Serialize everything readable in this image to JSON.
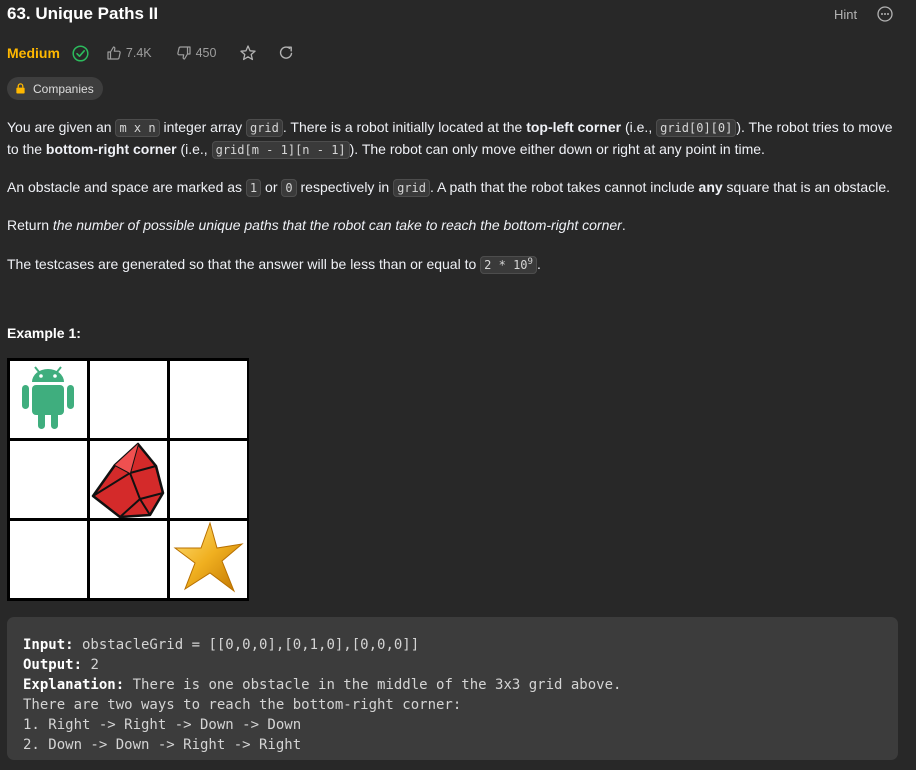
{
  "problem": {
    "title": "63. Unique Paths II",
    "hint_label": "Hint",
    "difficulty": "Medium",
    "likes": "7.4K",
    "dislikes": "450",
    "companies_label": "Companies"
  },
  "description": {
    "p1_a": "You are given an ",
    "p1_code1": "m x n",
    "p1_b": " integer array ",
    "p1_code2": "grid",
    "p1_c": ". There is a robot initially located at the ",
    "p1_bold1": "top-left corner",
    "p1_d": " (i.e., ",
    "p1_code3": "grid[0][0]",
    "p1_e": "). The robot tries to move to the ",
    "p1_bold2": "bottom-right corner",
    "p1_f": " (i.e., ",
    "p1_code4": "grid[m - 1][n - 1]",
    "p1_g": "). The robot can only move either down or right at any point in time.",
    "p2_a": "An obstacle and space are marked as ",
    "p2_code1": "1",
    "p2_b": " or ",
    "p2_code2": "0",
    "p2_c": " respectively in ",
    "p2_code3": "grid",
    "p2_d": ". A path that the robot takes cannot include ",
    "p2_bold": "any",
    "p2_e": " square that is an obstacle.",
    "p3_a": "Return ",
    "p3_italic": "the number of possible unique paths that the robot can take to reach the bottom-right corner",
    "p3_b": ".",
    "p4_a": "The testcases are generated so that the answer will be less than or equal to ",
    "p4_code": "2 * 10",
    "p4_sup": "9",
    "p4_b": "."
  },
  "example": {
    "title": "Example 1:",
    "input_label": "Input:",
    "input_value": " obstacleGrid = [[0,0,0],[0,1,0],[0,0,0]]",
    "output_label": "Output:",
    "output_value": " 2",
    "explanation_label": "Explanation:",
    "explanation_value": " There is one obstacle in the middle of the 3x3 grid above.",
    "line4": "There are two ways to reach the bottom-right corner:",
    "line5": "1. Right -> Right -> Down -> Down",
    "line6": "2. Down -> Down -> Right -> Right"
  },
  "colors": {
    "background": "#282828",
    "difficulty_medium": "#ffb800",
    "solved_green": "#2cbb5d",
    "robot": "#3fae7e",
    "obstacle": "#e03131",
    "star": "#f0b020"
  }
}
